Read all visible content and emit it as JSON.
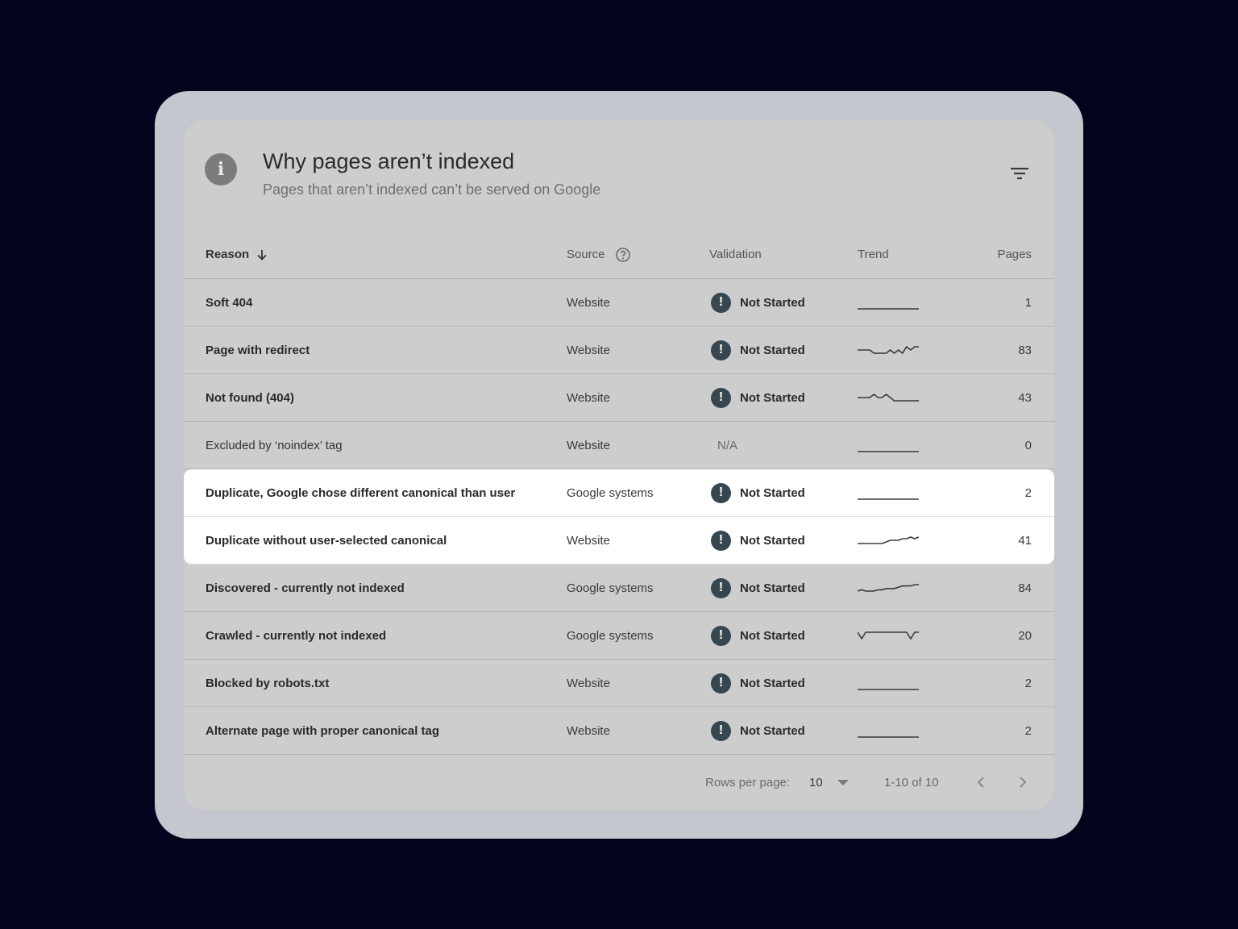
{
  "header": {
    "title": "Why pages aren’t indexed",
    "subtitle": "Pages that aren’t indexed can’t be served on Google",
    "info_icon": "info-icon",
    "filter_icon": "filter-icon"
  },
  "columns": {
    "reason": "Reason",
    "source": "Source",
    "validation": "Validation",
    "trend": "Trend",
    "pages": "Pages"
  },
  "rows": [
    {
      "reason": "Soft 404",
      "source": "Website",
      "validation": "Not Started",
      "pages": "1",
      "trend": [
        0,
        0,
        0,
        0,
        0,
        0,
        0,
        0,
        0,
        0,
        0,
        0,
        0,
        0,
        0,
        0
      ]
    },
    {
      "reason": "Page with redirect",
      "source": "Website",
      "validation": "Not Started",
      "pages": "83",
      "trend": [
        78,
        78,
        78,
        78,
        77,
        77,
        77,
        77,
        78,
        77,
        78,
        77,
        79,
        78,
        79,
        79
      ]
    },
    {
      "reason": "Not found (404)",
      "source": "Website",
      "validation": "Not Started",
      "pages": "43",
      "trend": [
        43,
        43,
        43,
        43,
        44,
        43,
        43,
        44,
        43,
        42,
        42,
        42,
        42,
        42,
        42,
        42
      ]
    },
    {
      "reason": "Excluded by ‘noindex’ tag",
      "source": "Website",
      "validation": "N/A",
      "pages": "0",
      "trend": [
        0,
        0,
        0,
        0,
        0,
        0,
        0,
        0,
        0,
        0,
        0,
        0,
        0,
        0,
        0,
        0
      ]
    },
    {
      "reason": "Duplicate, Google chose different canonical than user",
      "source": "Google systems",
      "validation": "Not Started",
      "pages": "2",
      "trend": [
        2,
        2,
        2,
        2,
        2,
        2,
        2,
        2,
        2,
        2,
        2,
        2,
        2,
        2,
        2,
        2
      ]
    },
    {
      "reason": "Duplicate without user-selected canonical",
      "source": "Website",
      "validation": "Not Started",
      "pages": "41",
      "trend": [
        37,
        37,
        37,
        37,
        37,
        37,
        37,
        38,
        39,
        39,
        39,
        40,
        40,
        41,
        40,
        41
      ]
    },
    {
      "reason": "Discovered - currently not indexed",
      "source": "Google systems",
      "validation": "Not Started",
      "pages": "84",
      "trend": [
        79,
        80,
        79,
        79,
        79,
        80,
        80,
        81,
        81,
        81,
        82,
        83,
        83,
        83,
        84,
        84
      ]
    },
    {
      "reason": "Crawled - currently not indexed",
      "source": "Google systems",
      "validation": "Not Started",
      "pages": "20",
      "trend": [
        20,
        19,
        20,
        20,
        20,
        20,
        20,
        20,
        20,
        20,
        20,
        20,
        20,
        19,
        20,
        20
      ]
    },
    {
      "reason": "Blocked by robots.txt",
      "source": "Website",
      "validation": "Not Started",
      "pages": "2",
      "trend": [
        2,
        2,
        2,
        2,
        2,
        2,
        2,
        2,
        2,
        2,
        2,
        2,
        2,
        2,
        2,
        2
      ]
    },
    {
      "reason": "Alternate page with proper canonical tag",
      "source": "Website",
      "validation": "Not Started",
      "pages": "2",
      "trend": [
        2,
        2,
        2,
        2,
        2,
        2,
        2,
        2,
        2,
        2,
        2,
        2,
        2,
        2,
        2,
        2
      ]
    }
  ],
  "highlighted_rows": [
    4,
    5
  ],
  "footer": {
    "rows_per_page_label": "Rows per page:",
    "rows_per_page_value": "10",
    "range": "1-10 of 10"
  },
  "colors": {
    "page_background": "#02041e",
    "frame": "#c4c7ce",
    "card": "#cdcdcd",
    "highlight": "#ffffff",
    "warning_icon": "#37474f"
  }
}
